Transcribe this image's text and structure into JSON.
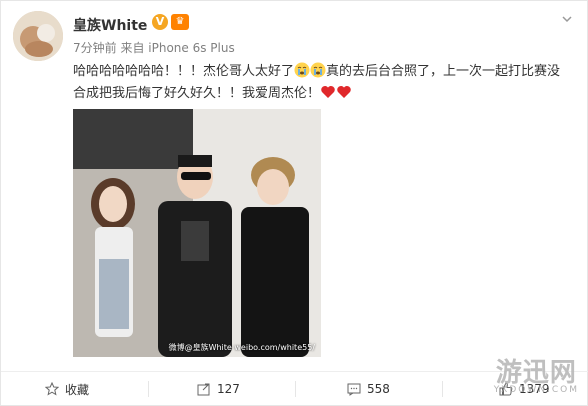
{
  "user": {
    "name": "皇族White",
    "vip_badge": "V",
    "member_badge": "♛",
    "meta": "7分钟前 来自 iPhone 6s Plus"
  },
  "post": {
    "text_part1": "哈哈哈哈哈哈哈！！！杰伦哥人太好了",
    "text_part2": "真的去后台合照了，上一次一起打比赛没合成把我后悔了好久好久！！我爱周杰伦！",
    "photo_watermark": "微博@皇族White\nweibo.com/white55/"
  },
  "actions": {
    "favorite_label": "收藏",
    "share_count": "127",
    "comment_count": "558",
    "like_count": "1379"
  },
  "site_mark": {
    "big": "游迅网",
    "small": "YXDOWN.COM"
  },
  "icons": [
    "avatar",
    "chevron-down-icon",
    "crying-emoji-icon",
    "heart-emoji-icon",
    "star-icon",
    "share-icon",
    "comment-icon",
    "thumbs-up-icon"
  ],
  "colors": {
    "accent": "#ff8200",
    "meta_gray": "#808080",
    "heart": "#e0282b"
  }
}
